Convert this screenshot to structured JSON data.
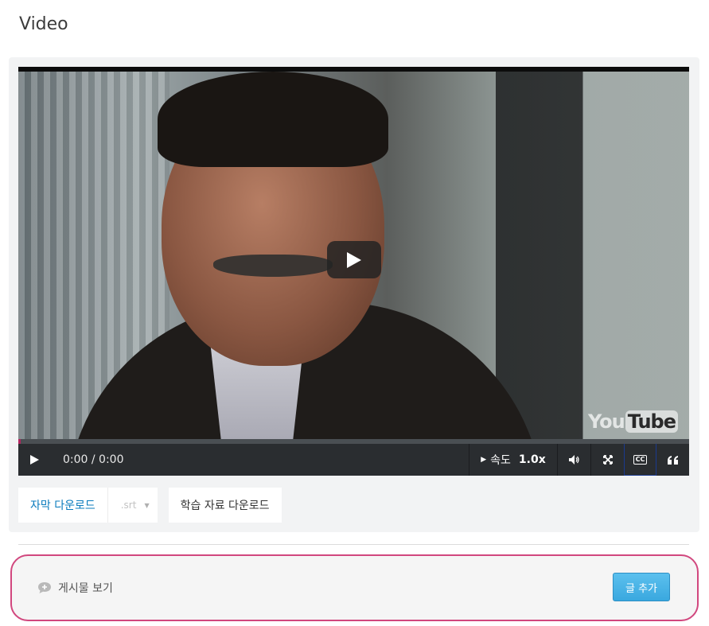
{
  "page": {
    "title": "Video"
  },
  "player": {
    "time": "0:00 / 0:00",
    "speed_label": "속도",
    "speed_value": "1.0x",
    "youtube_logo_a": "You",
    "youtube_logo_b": "Tube",
    "progress_fraction": 0
  },
  "downloads": {
    "transcript_label": "자막 다운로드",
    "format_selected": ".srt",
    "handouts_label": "학습 자료 다운로드"
  },
  "discussion": {
    "show_posts_label": "게시물 보기",
    "add_post_label": "글 추가"
  },
  "colors": {
    "accent_link": "#0a7bbd",
    "progress_marker": "#b2255f",
    "highlight_outline": "#d1477e",
    "add_button": "#3aa8df"
  }
}
